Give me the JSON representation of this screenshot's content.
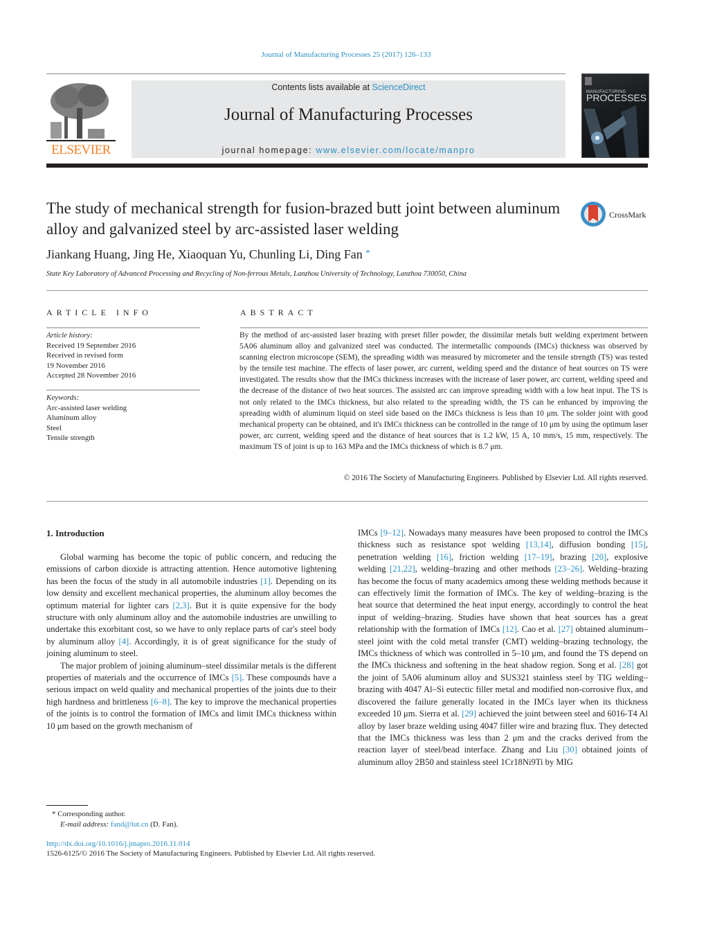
{
  "header": {
    "journal_ref": "Journal of Manufacturing Processes 25 (2017) 126–133",
    "contents_prefix": "Contents lists available at ",
    "contents_link": "ScienceDirect",
    "journal_title": "Journal of Manufacturing Processes",
    "homepage_prefix": "journal homepage: ",
    "homepage_link": "www.elsevier.com/locate/manpro",
    "publisher_logo": "ELSEVIER",
    "cover": {
      "small": "MANUFACTURING",
      "big": "PROCESSES"
    },
    "crossmark_label": "CrossMark"
  },
  "article": {
    "title": "The study of mechanical strength for fusion-brazed butt joint between aluminum alloy and galvanized steel by arc-assisted laser welding",
    "authors": "Jiankang Huang, Jing He, Xiaoquan Yu, Chunling Li, Ding Fan",
    "corresponding_marker": "*",
    "affiliation": "State Key Laboratory of Advanced Processing and Recycling of Non-ferrous Metals, Lanzhou University of Technology, Lanzhou 730050, China"
  },
  "article_info": {
    "heading": "ARTICLE INFO",
    "history_label": "Article history:",
    "history": [
      "Received 19 September 2016",
      "Received in revised form",
      "19 November 2016",
      "Accepted 28 November 2016"
    ],
    "keywords_label": "Keywords:",
    "keywords": [
      "Arc-assisted laser welding",
      "Aluminum alloy",
      "Steel",
      "Tensile strength"
    ]
  },
  "abstract": {
    "heading": "ABSTRACT",
    "text": "By the method of arc-assisted laser brazing with preset filler powder, the dissimilar metals butt welding experiment between 5A06 aluminum alloy and galvanized steel was conducted. The intermetallic compounds (IMCs) thickness was observed by scanning electron microscope (SEM), the spreading width was measured by micrometer and the tensile strength (TS) was tested by the tensile test machine. The effects of laser power, arc current, welding speed and the distance of heat sources on TS were investigated. The results show that the IMCs thickness increases with the increase of laser power, arc current, welding speed and the decrease of the distance of two heat sources. The assisted arc can improve spreading width with a low heat input. The TS is not only related to the IMCs thickness, but also related to the spreading width, the TS can be enhanced by improving the spreading width of aluminum liquid on steel side based on the IMCs thickness is less than 10 μm. The solder joint with good mechanical property can be obtained, and it's IMCs thickness can be controlled in the range of 10 μm by using the optimum laser power, arc current, welding speed and the distance of heat sources that is 1.2 kW, 15 A, 10 mm/s, 15 mm, respectively. The maximum TS of joint is up to 163 MPa and the IMCs thickness of which is 8.7 μm.",
    "copyright": "© 2016 The Society of Manufacturing Engineers. Published by Elsevier Ltd. All rights reserved."
  },
  "body": {
    "section_heading": "1.  Introduction",
    "left_paragraphs": [
      [
        {
          "t": "Global warming has become the topic of public concern, and reducing the emissions of carbon dioxide is attracting attention. Hence automotive lightening has been the focus of the study in all automobile industries "
        },
        {
          "ref": "[1]"
        },
        {
          "t": ". Depending on its low density and excellent mechanical properties, the aluminum alloy becomes the optimum material for lighter cars "
        },
        {
          "ref": "[2,3]"
        },
        {
          "t": ". But it is quite expensive for the body structure with only aluminum alloy and the automobile industries are unwilling to undertake this exorbitant cost, so we have to only replace parts of car's steel body by aluminum alloy "
        },
        {
          "ref": "[4]"
        },
        {
          "t": ". Accordingly, it is of great significance for the study of joining aluminum to steel."
        }
      ],
      [
        {
          "t": "The major problem of joining aluminum–steel dissimilar metals is the different properties of materials and the occurrence of IMCs "
        },
        {
          "ref": "[5]"
        },
        {
          "t": ". These compounds have a serious impact on weld quality and mechanical properties of the joints due to their high hardness and brittleness "
        },
        {
          "ref": "[6–8]"
        },
        {
          "t": ". The key to improve the mechanical properties of the joints is to control the formation of IMCs and limit IMCs thickness within 10 μm based on the growth mechanism of"
        }
      ]
    ],
    "right_paragraphs": [
      [
        {
          "t": "IMCs "
        },
        {
          "ref": "[9–12]"
        },
        {
          "t": ". Nowadays many measures have been proposed to control the IMCs thickness such as resistance spot welding "
        },
        {
          "ref": "[13,14]"
        },
        {
          "t": ", diffusion bonding "
        },
        {
          "ref": "[15]"
        },
        {
          "t": ", penetration welding "
        },
        {
          "ref": "[16]"
        },
        {
          "t": ", friction welding "
        },
        {
          "ref": "[17–19]"
        },
        {
          "t": ", brazing "
        },
        {
          "ref": "[20]"
        },
        {
          "t": ", explosive welding "
        },
        {
          "ref": "[21,22]"
        },
        {
          "t": ", welding–brazing and other methods "
        },
        {
          "ref": "[23–26]"
        },
        {
          "t": ". Welding–brazing has become the focus of many academics among these welding methods because it can effectively limit the formation of IMCs. The key of welding–brazing is the heat source that determined the heat input energy, accordingly to control the heat input of welding–brazing. Studies have shown that heat sources has a great relationship with the formation of IMCs "
        },
        {
          "ref": "[12]"
        },
        {
          "t": ". Cao et al. "
        },
        {
          "ref": "[27]"
        },
        {
          "t": " obtained aluminum–steel joint with the cold metal transfer (CMT) welding–brazing technology, the IMCs thickness of which was controlled in 5–10 μm, and found the TS depend on the IMCs thickness and softening in the heat shadow region. Song et al. "
        },
        {
          "ref": "[28]"
        },
        {
          "t": " got the joint of 5A06 aluminum alloy and SUS321 stainless steel by TIG welding–brazing with 4047 Al–Si eutectic filler metal and modified non-corrosive flux, and discovered the failure generally located in the IMCs layer when its thickness exceeded 10 μm. Sierra et al. "
        },
        {
          "ref": "[29]"
        },
        {
          "t": " achieved the joint between steel and 6016-T4 Al alloy by laser braze welding using 4047 filler wire and brazing flux. They detected that the IMCs thickness was less than 2 μm and the cracks derived from the reaction layer of steel/bead interface. Zhang and Liu "
        },
        {
          "ref": "[30]"
        },
        {
          "t": " obtained joints of aluminum alloy 2B50 and stainless steel 1Cr18Ni9Ti by MIG"
        }
      ]
    ]
  },
  "footnote": {
    "marker": "*",
    "corresponding": "Corresponding author.",
    "email_label": "E-mail address:",
    "email": "fand@lut.cn",
    "email_suffix": " (D. Fan)."
  },
  "footer": {
    "doi": "http://dx.doi.org/10.1016/j.jmapro.2016.11.014",
    "issn_copyright": "1526-6125/© 2016 The Society of Manufacturing Engineers. Published by Elsevier Ltd. All rights reserved."
  }
}
